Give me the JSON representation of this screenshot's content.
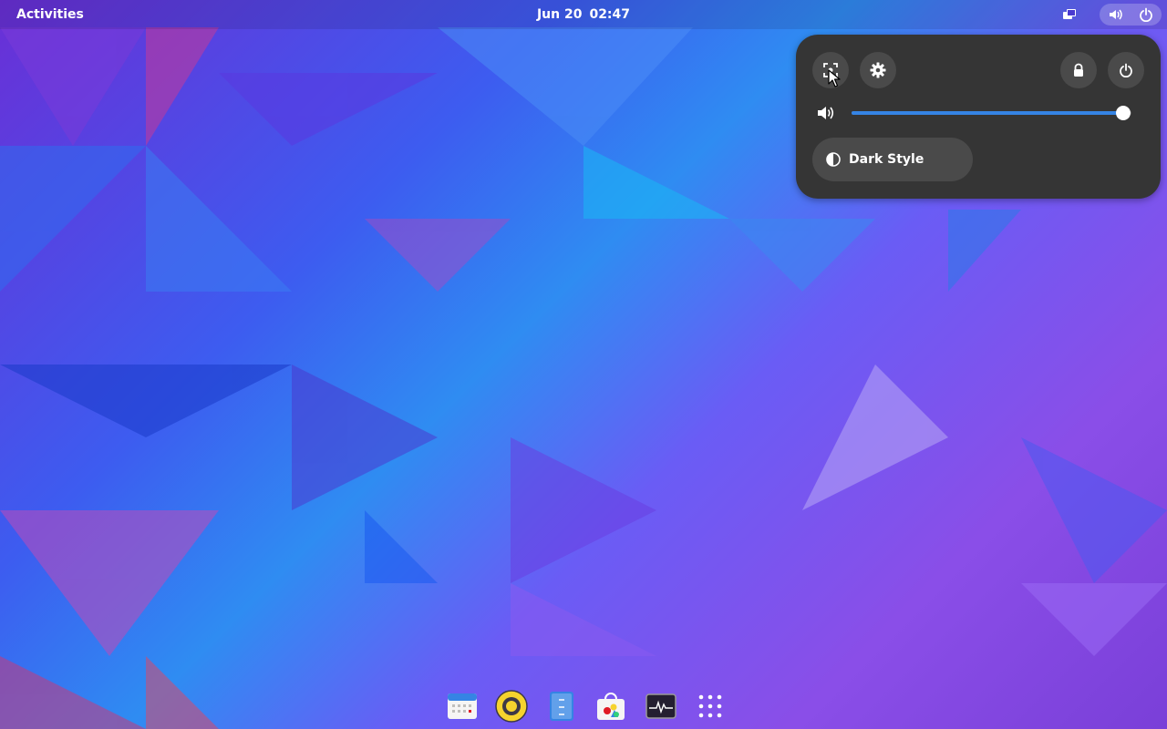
{
  "topbar": {
    "activities_label": "Activities",
    "clock_date": "Jun 20",
    "clock_time": "02:47"
  },
  "quick_settings": {
    "volume_level": 0.97,
    "dark_style_label": "Dark Style",
    "buttons": [
      "screenshot-icon",
      "gear-icon",
      "lock-icon",
      "power-icon"
    ]
  },
  "dock": {
    "items": [
      "calendar-icon",
      "rhythmbox-icon",
      "text-editor-icon",
      "software-icon",
      "system-monitor-icon",
      "app-grid-icon"
    ]
  },
  "colors": {
    "panel": "#353535",
    "button": "#4a4a4a",
    "accent": "#3584e4"
  }
}
